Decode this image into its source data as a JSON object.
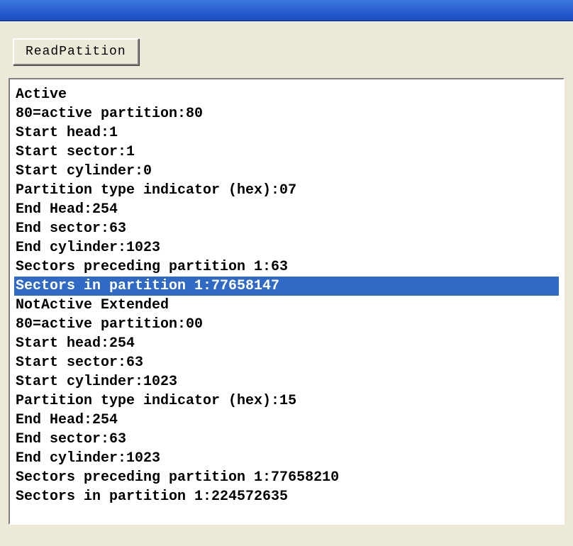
{
  "toolbar": {
    "read_button_label": "ReadPatition"
  },
  "output": {
    "lines": [
      {
        "text": "Active",
        "selected": false
      },
      {
        "text": "80=active partition:80",
        "selected": false
      },
      {
        "text": "Start head:1",
        "selected": false
      },
      {
        "text": "Start sector:1",
        "selected": false
      },
      {
        "text": "Start cylinder:0",
        "selected": false
      },
      {
        "text": "Partition type indicator (hex):07",
        "selected": false
      },
      {
        "text": "End Head:254",
        "selected": false
      },
      {
        "text": "End sector:63",
        "selected": false
      },
      {
        "text": "End cylinder:1023",
        "selected": false
      },
      {
        "text": "Sectors preceding partition 1:63",
        "selected": false
      },
      {
        "text": "Sectors in partition 1:77658147",
        "selected": true
      },
      {
        "text": "NotActive Extended",
        "selected": false
      },
      {
        "text": "80=active partition:00",
        "selected": false
      },
      {
        "text": "Start head:254",
        "selected": false
      },
      {
        "text": "Start sector:63",
        "selected": false
      },
      {
        "text": "Start cylinder:1023",
        "selected": false
      },
      {
        "text": "Partition type indicator (hex):15",
        "selected": false
      },
      {
        "text": "End Head:254",
        "selected": false
      },
      {
        "text": "End sector:63",
        "selected": false
      },
      {
        "text": "End cylinder:1023",
        "selected": false
      },
      {
        "text": "Sectors preceding partition 1:77658210",
        "selected": false
      },
      {
        "text": "Sectors in partition 1:224572635",
        "selected": false
      }
    ]
  }
}
